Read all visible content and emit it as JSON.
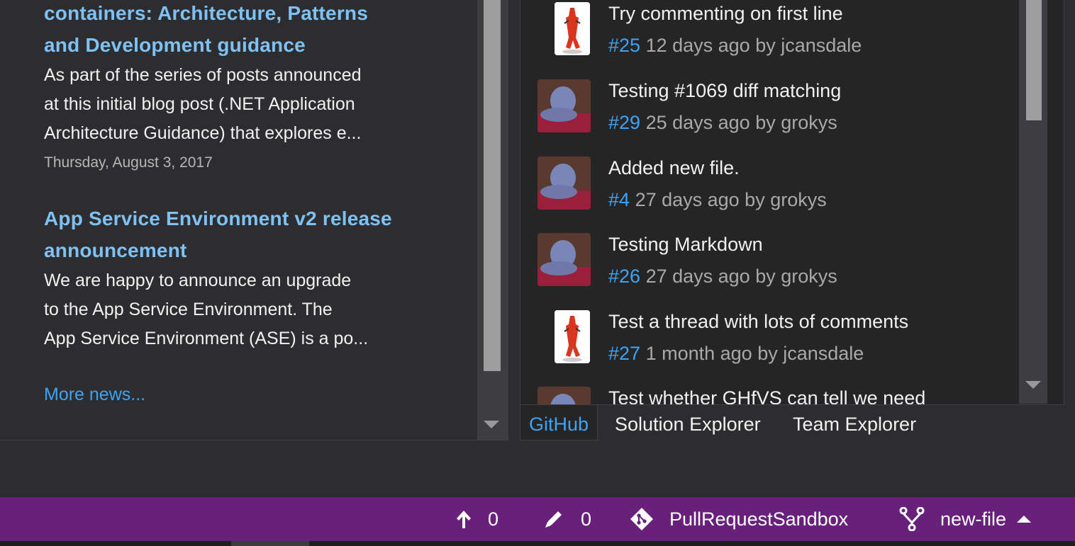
{
  "news": {
    "items": [
      {
        "title_line1": "containers: Architecture, Patterns",
        "title_line2": "and Development guidance",
        "body_line1": "As part of the series of posts announced",
        "body_line2": "at this initial blog post (.NET Application",
        "body_line3": "Architecture Guidance) that explores e...",
        "date": "Thursday, August 3, 2017"
      },
      {
        "title_line1": "App Service Environment v2 release",
        "title_line2": "announcement",
        "body_line1": "We are happy to announce an upgrade",
        "body_line2": "to the App Service Environment. The",
        "body_line3": "App Service Environment (ASE) is a po..."
      }
    ],
    "more_link": "More news..."
  },
  "pull_requests": [
    {
      "title": "Try commenting on first line",
      "number": "#25",
      "meta": "12 days ago by jcansdale",
      "avatar": "octocat-avatar"
    },
    {
      "title": "Testing #1069 diff matching",
      "number": "#29",
      "meta": "25 days ago by grokys",
      "avatar": "person-avatar"
    },
    {
      "title": "Added new file.",
      "number": "#4",
      "meta": "27 days ago by grokys",
      "avatar": "person-avatar"
    },
    {
      "title": "Testing Markdown",
      "number": "#26",
      "meta": "27 days ago by grokys",
      "avatar": "person-avatar"
    },
    {
      "title": "Test a thread with lots of comments",
      "number": "#27",
      "meta": "1 month ago by jcansdale",
      "avatar": "octocat-avatar"
    },
    {
      "title": "Test whether GHfVS can tell we need",
      "number": "",
      "meta": "",
      "avatar": "person-avatar"
    }
  ],
  "tabs": {
    "github": "GitHub",
    "solution_explorer": "Solution Explorer",
    "team_explorer": "Team Explorer"
  },
  "status_bar": {
    "unpushed_count": "0",
    "pending_changes_count": "0",
    "repository": "PullRequestSandbox",
    "branch": "new-file"
  },
  "colors": {
    "status_bar": "#68217a",
    "link": "#3ea3f5",
    "news_title": "#7ec2f5",
    "panel_bg": "#252526",
    "window_bg": "#2d2d30"
  }
}
